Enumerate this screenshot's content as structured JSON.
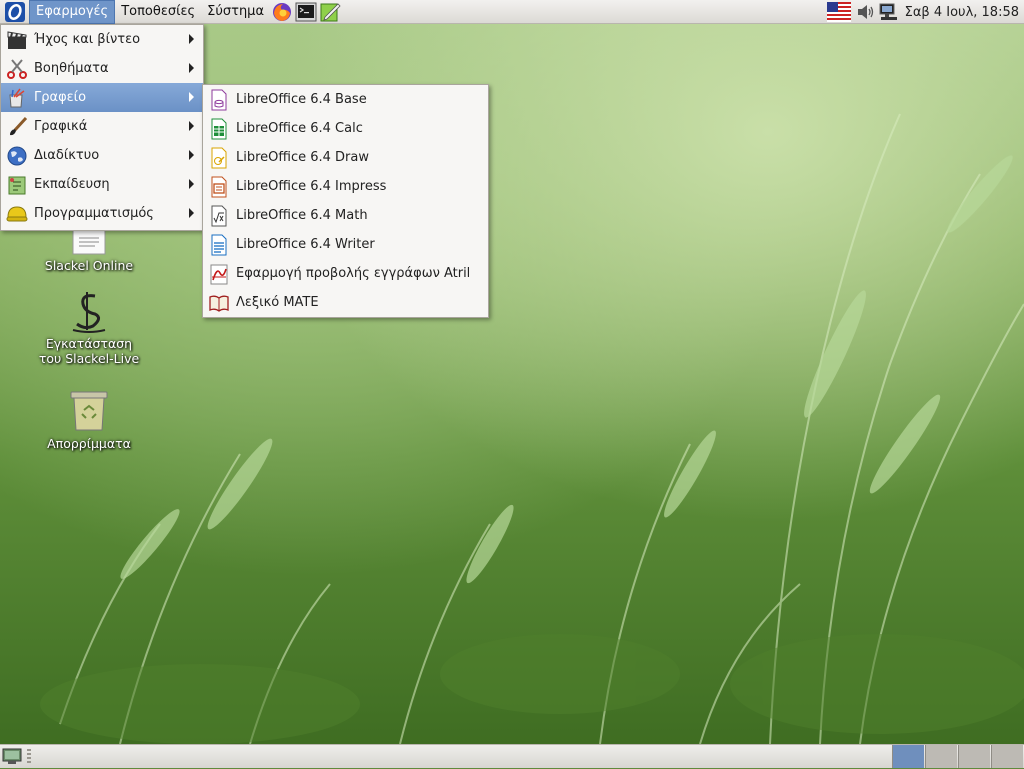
{
  "top_panel": {
    "menus": [
      "Εφαρμογές",
      "Τοποθεσίες",
      "Σύστημα"
    ],
    "launchers": [
      "firefox-icon",
      "terminal-icon",
      "text-editor-icon"
    ],
    "clock": "Σαβ  4 Ιουλ, 18:58",
    "tray": [
      "us-flag-icon",
      "volume-icon",
      "network-icon"
    ]
  },
  "main_menu": {
    "items": [
      {
        "label": "Ήχος και βίντεο",
        "icon": "clapperboard-icon"
      },
      {
        "label": "Βοηθήματα",
        "icon": "scissors-icon"
      },
      {
        "label": "Γραφείο",
        "icon": "office-icon",
        "selected": true
      },
      {
        "label": "Γραφικά",
        "icon": "paintbrush-icon"
      },
      {
        "label": "Διαδίκτυο",
        "icon": "globe-icon"
      },
      {
        "label": "Εκπαίδευση",
        "icon": "education-icon"
      },
      {
        "label": "Προγραμματισμός",
        "icon": "programming-icon"
      }
    ]
  },
  "office_submenu": {
    "items": [
      {
        "label": "LibreOffice 6.4 Base",
        "icon": "libreoffice-base-icon",
        "color": "#8e3b9c"
      },
      {
        "label": "LibreOffice 6.4 Calc",
        "icon": "libreoffice-calc-icon",
        "color": "#1e8f3a"
      },
      {
        "label": "LibreOffice 6.4 Draw",
        "icon": "libreoffice-draw-icon",
        "color": "#d9a400"
      },
      {
        "label": "LibreOffice 6.4 Impress",
        "icon": "libreoffice-impress-icon",
        "color": "#c0501c"
      },
      {
        "label": "LibreOffice 6.4 Math",
        "icon": "libreoffice-math-icon",
        "color": "#555555"
      },
      {
        "label": "LibreOffice 6.4 Writer",
        "icon": "libreoffice-writer-icon",
        "color": "#1a6fc2"
      },
      {
        "label": "Εφαρμογή προβολής εγγράφων Atril",
        "icon": "atril-icon",
        "color": "#c41a1a"
      },
      {
        "label": "Λεξικό MATE",
        "icon": "dictionary-icon",
        "color": "#a02020"
      }
    ]
  },
  "desktop_icons": [
    {
      "label": "Slackel Online",
      "icon": "document-icon"
    },
    {
      "label": "Εγκατάσταση του Slackel-Live",
      "icon": "slackel-installer-icon"
    },
    {
      "label": "Απορρίμματα",
      "icon": "trash-icon"
    }
  ],
  "bottom_panel": {
    "workspaces": 4,
    "active_workspace": 1
  }
}
